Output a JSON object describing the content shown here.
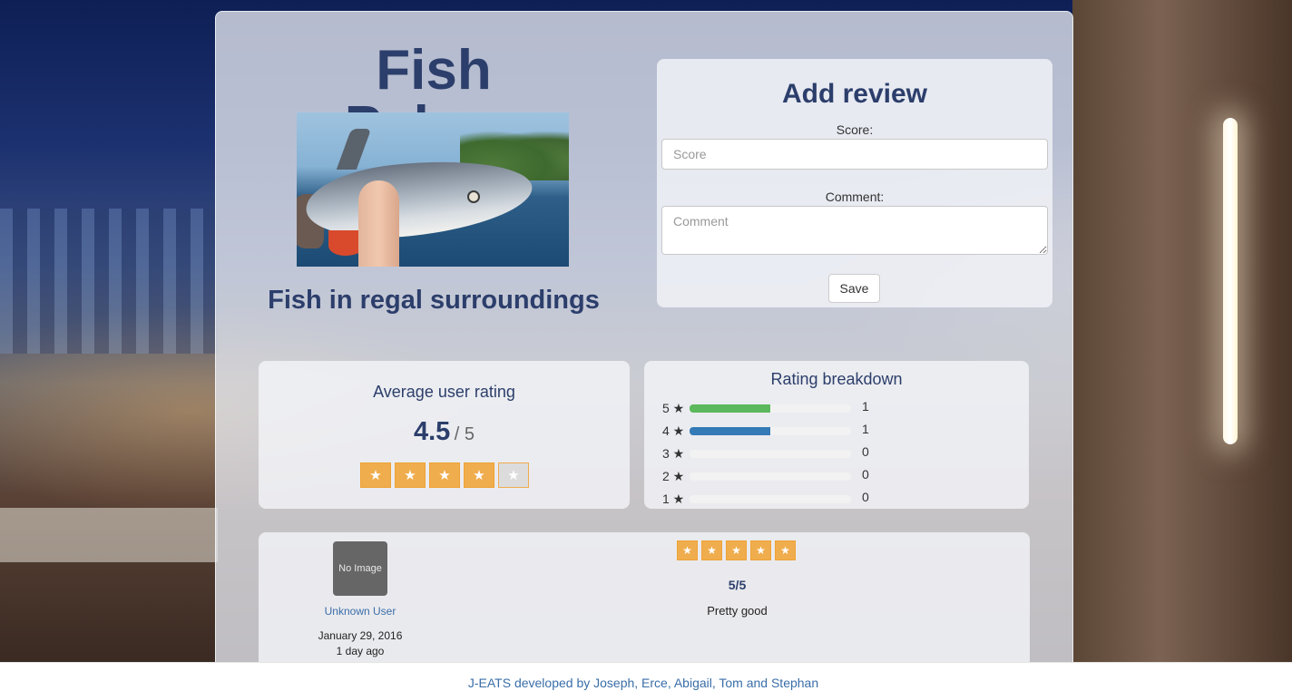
{
  "restaurant": {
    "name": "Fish Palace",
    "description": "Fish in regal surroundings"
  },
  "add_review": {
    "title": "Add review",
    "score_label": "Score:",
    "score_placeholder": "Score",
    "score_value": "",
    "comment_label": "Comment:",
    "comment_placeholder": "Comment",
    "comment_value": "",
    "save_label": "Save"
  },
  "average": {
    "title": "Average user rating",
    "value": "4.5",
    "out_of": "/ 5",
    "stars_filled": 4,
    "stars_total": 5,
    "star_glyph": "★"
  },
  "breakdown": {
    "title": "Rating breakdown",
    "rows": [
      {
        "label": "5 ★",
        "count": "1",
        "fraction": 0.5,
        "color": "#5cb85c"
      },
      {
        "label": "4 ★",
        "count": "1",
        "fraction": 0.5,
        "color": "#337ab7"
      },
      {
        "label": "3 ★",
        "count": "0",
        "fraction": 0,
        "color": "#f0ad4e"
      },
      {
        "label": "2 ★",
        "count": "0",
        "fraction": 0,
        "color": "#f0ad4e"
      },
      {
        "label": "1 ★",
        "count": "0",
        "fraction": 0,
        "color": "#d9534f"
      }
    ]
  },
  "reviews": [
    {
      "avatar_text": "No Image",
      "user": "Unknown User",
      "date": "January 29, 2016",
      "ago": "1 day ago",
      "stars_filled": 5,
      "score": "5/5",
      "comment": "Pretty good"
    }
  ],
  "footer": {
    "text": "J-EATS developed by Joseph, Erce, Abigail, Tom and Stephan"
  },
  "colors": {
    "accent": "#2c3e6b",
    "star": "#f0ad4e",
    "link": "#3a6ea8"
  }
}
